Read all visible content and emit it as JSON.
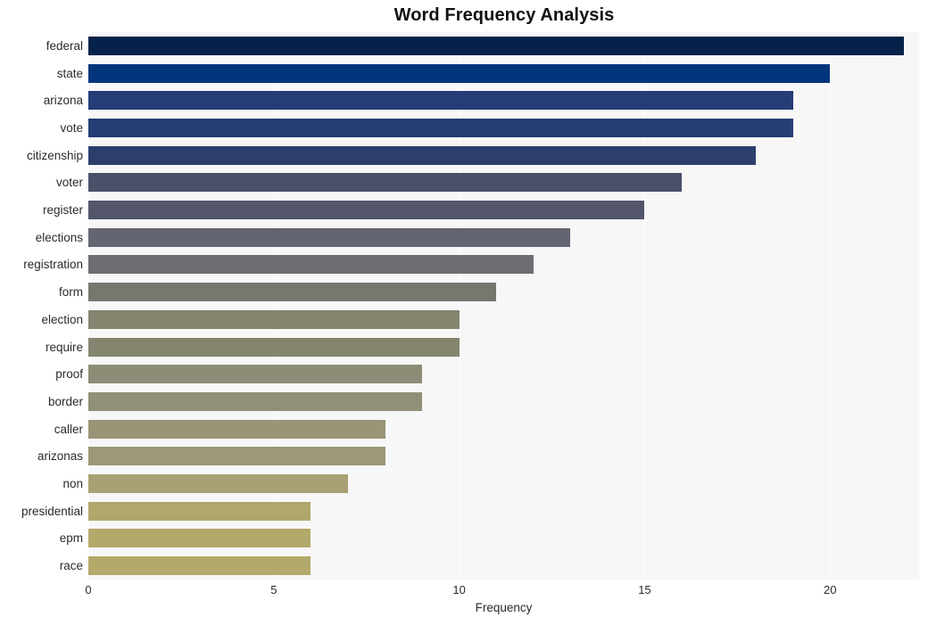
{
  "chart_data": {
    "type": "bar",
    "orientation": "horizontal",
    "title": "Word Frequency Analysis",
    "xlabel": "Frequency",
    "ylabel": "",
    "xlim": [
      0,
      22.4
    ],
    "ylim": [
      0,
      20
    ],
    "grid": true,
    "legend": null,
    "xticks": [
      0,
      5,
      10,
      15,
      20
    ],
    "xtick_labels": [
      "0",
      "5",
      "10",
      "15",
      "20"
    ],
    "categories": [
      "federal",
      "state",
      "arizona",
      "vote",
      "citizenship",
      "voter",
      "register",
      "elections",
      "registration",
      "form",
      "election",
      "require",
      "proof",
      "border",
      "caller",
      "arizonas",
      "non",
      "presidential",
      "epm",
      "race"
    ],
    "values": [
      22,
      20,
      19,
      19,
      18,
      16,
      15,
      13,
      12,
      11,
      10,
      10,
      9,
      9,
      8,
      8,
      7,
      6,
      6,
      6
    ],
    "bar_colors": [
      "#06224b",
      "#03357c",
      "#253c77",
      "#263e74",
      "#2c3f6c",
      "#4a5069",
      "#53556a",
      "#646572",
      "#6d6d72",
      "#77776f",
      "#84846f",
      "#84846f",
      "#8d8c76",
      "#918f78",
      "#9a9577",
      "#9c9777",
      "#a9a173",
      "#b0a76c",
      "#b3a96a",
      "#b3a96a"
    ],
    "plot_background": "#f7f7f7",
    "gridline_color": "#ffffff",
    "figure_background": "#ffffff",
    "title_color": "#111111",
    "tick_color": "#2b2b2b"
  }
}
